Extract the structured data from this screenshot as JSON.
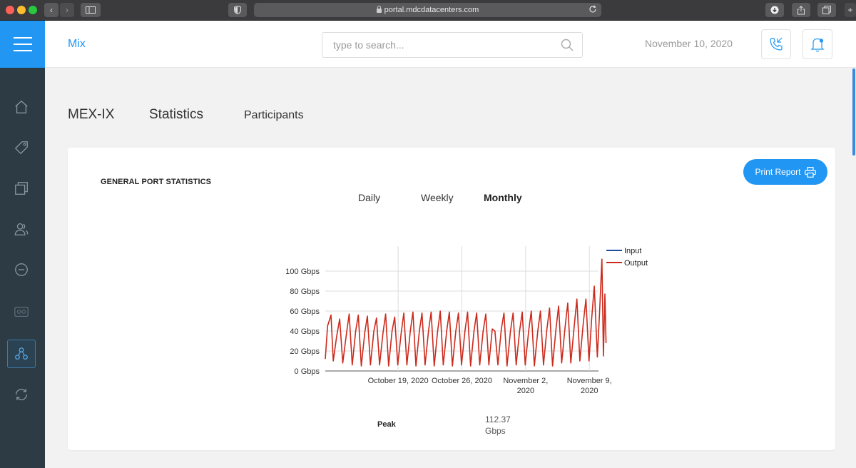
{
  "browser": {
    "url": "portal.mdcdatacenters.com"
  },
  "header": {
    "brand": "Mix",
    "search_placeholder": "type to search...",
    "date": "November 10, 2020"
  },
  "sidebar": {
    "items": [
      {
        "name": "home",
        "icon": "home-icon"
      },
      {
        "name": "tags",
        "icon": "tag-icon"
      },
      {
        "name": "copy",
        "icon": "copy-icon"
      },
      {
        "name": "users",
        "icon": "users-icon"
      },
      {
        "name": "minus",
        "icon": "minus-circle-icon"
      },
      {
        "name": "ports",
        "icon": "ports-icon"
      },
      {
        "name": "network",
        "icon": "network-icon",
        "active": true
      },
      {
        "name": "refresh",
        "icon": "refresh-icon"
      }
    ]
  },
  "page_tabs": {
    "site": "MEX-IX",
    "statistics": "Statistics",
    "participants": "Participants"
  },
  "card": {
    "title": "GENERAL PORT STATISTICS",
    "print_label": "Print Report",
    "periods": [
      "Daily",
      "Weekly",
      "Monthly"
    ],
    "selected_period": "Monthly",
    "peak_label": "Peak",
    "peak_value": "112.37 Gbps"
  },
  "colors": {
    "accent": "#2196f3",
    "input": "#1f4ea1",
    "output": "#cc2a1c"
  },
  "chart_data": {
    "type": "line",
    "y_ticks": [
      "100 Gbps",
      "80 Gbps",
      "60 Gbps",
      "40 Gbps",
      "20 Gbps",
      "0 Gbps"
    ],
    "y_tick_values": [
      100,
      80,
      60,
      40,
      20,
      0
    ],
    "ylim": [
      0,
      125
    ],
    "x_ticks": [
      {
        "label": [
          "October 19, 2020"
        ],
        "date": "2020-10-19"
      },
      {
        "label": [
          "October 26, 2020"
        ],
        "date": "2020-10-26"
      },
      {
        "label": [
          "November 2,",
          "2020"
        ],
        "date": "2020-11-02"
      },
      {
        "label": [
          "November 9,",
          "2020"
        ],
        "date": "2020-11-09"
      }
    ],
    "xlim": [
      "2020-10-11",
      "2020-11-10"
    ],
    "legend_position": "right",
    "grid": true,
    "series": [
      {
        "name": "Input",
        "color": "#1f4ea1",
        "points": []
      },
      {
        "name": "Output",
        "color": "#cc2a1c",
        "points": [
          [
            "2020-10-11 00:00",
            12
          ],
          [
            "2020-10-11 06:00",
            45
          ],
          [
            "2020-10-11 15:00",
            56
          ],
          [
            "2020-10-11 21:00",
            10
          ],
          [
            "2020-10-12 06:00",
            35
          ],
          [
            "2020-10-12 14:00",
            52
          ],
          [
            "2020-10-12 22:00",
            8
          ],
          [
            "2020-10-13 08:00",
            38
          ],
          [
            "2020-10-13 15:00",
            57
          ],
          [
            "2020-10-13 23:00",
            6
          ],
          [
            "2020-10-14 08:00",
            40
          ],
          [
            "2020-10-14 15:00",
            56
          ],
          [
            "2020-10-14 23:00",
            5
          ],
          [
            "2020-10-15 08:00",
            38
          ],
          [
            "2020-10-15 15:00",
            55
          ],
          [
            "2020-10-15 23:00",
            6
          ],
          [
            "2020-10-16 08:00",
            40
          ],
          [
            "2020-10-16 15:00",
            53
          ],
          [
            "2020-10-16 23:00",
            6
          ],
          [
            "2020-10-17 08:00",
            38
          ],
          [
            "2020-10-17 15:00",
            57
          ],
          [
            "2020-10-17 23:00",
            5
          ],
          [
            "2020-10-18 08:00",
            40
          ],
          [
            "2020-10-18 15:00",
            54
          ],
          [
            "2020-10-18 23:00",
            6
          ],
          [
            "2020-10-19 08:00",
            38
          ],
          [
            "2020-10-19 15:00",
            58
          ],
          [
            "2020-10-19 23:00",
            6
          ],
          [
            "2020-10-20 08:00",
            40
          ],
          [
            "2020-10-20 15:00",
            59
          ],
          [
            "2020-10-20 23:00",
            5
          ],
          [
            "2020-10-21 08:00",
            40
          ],
          [
            "2020-10-21 15:00",
            58
          ],
          [
            "2020-10-21 23:00",
            6
          ],
          [
            "2020-10-22 08:00",
            40
          ],
          [
            "2020-10-22 15:00",
            59
          ],
          [
            "2020-10-22 23:00",
            5
          ],
          [
            "2020-10-23 08:00",
            40
          ],
          [
            "2020-10-23 15:00",
            60
          ],
          [
            "2020-10-23 23:00",
            6
          ],
          [
            "2020-10-24 08:00",
            40
          ],
          [
            "2020-10-24 15:00",
            59
          ],
          [
            "2020-10-24 23:00",
            5
          ],
          [
            "2020-10-25 08:00",
            40
          ],
          [
            "2020-10-25 15:00",
            58
          ],
          [
            "2020-10-25 23:00",
            6
          ],
          [
            "2020-10-26 08:00",
            40
          ],
          [
            "2020-10-26 15:00",
            59
          ],
          [
            "2020-10-26 23:00",
            5
          ],
          [
            "2020-10-27 08:00",
            40
          ],
          [
            "2020-10-27 15:00",
            58
          ],
          [
            "2020-10-27 23:00",
            6
          ],
          [
            "2020-10-28 08:00",
            40
          ],
          [
            "2020-10-28 15:00",
            57
          ],
          [
            "2020-10-28 23:00",
            6
          ],
          [
            "2020-10-29 08:00",
            42
          ],
          [
            "2020-10-29 15:00",
            40
          ],
          [
            "2020-10-29 23:00",
            6
          ],
          [
            "2020-10-30 08:00",
            42
          ],
          [
            "2020-10-30 15:00",
            58
          ],
          [
            "2020-10-30 23:00",
            5
          ],
          [
            "2020-10-31 08:00",
            40
          ],
          [
            "2020-10-31 15:00",
            58
          ],
          [
            "2020-10-31 23:00",
            6
          ],
          [
            "2020-11-01 08:00",
            40
          ],
          [
            "2020-11-01 15:00",
            59
          ],
          [
            "2020-11-01 23:00",
            6
          ],
          [
            "2020-11-02 08:00",
            40
          ],
          [
            "2020-11-02 15:00",
            60
          ],
          [
            "2020-11-02 23:00",
            5
          ],
          [
            "2020-11-03 08:00",
            40
          ],
          [
            "2020-11-03 15:00",
            60
          ],
          [
            "2020-11-03 23:00",
            6
          ],
          [
            "2020-11-04 08:00",
            42
          ],
          [
            "2020-11-04 15:00",
            63
          ],
          [
            "2020-11-04 23:00",
            5
          ],
          [
            "2020-11-05 08:00",
            42
          ],
          [
            "2020-11-05 15:00",
            65
          ],
          [
            "2020-11-05 23:00",
            8
          ],
          [
            "2020-11-06 08:00",
            44
          ],
          [
            "2020-11-06 15:00",
            68
          ],
          [
            "2020-11-06 23:00",
            8
          ],
          [
            "2020-11-07 08:00",
            45
          ],
          [
            "2020-11-07 15:00",
            72
          ],
          [
            "2020-11-07 23:00",
            10
          ],
          [
            "2020-11-08 08:00",
            48
          ],
          [
            "2020-11-08 15:00",
            72
          ],
          [
            "2020-11-08 23:00",
            10
          ],
          [
            "2020-11-09 06:00",
            52
          ],
          [
            "2020-11-09 13:00",
            85
          ],
          [
            "2020-11-09 21:00",
            14
          ],
          [
            "2020-11-10 03:00",
            60
          ],
          [
            "2020-11-10 09:00",
            112
          ],
          [
            "2020-11-10 13:00",
            15
          ],
          [
            "2020-11-10 17:00",
            77
          ],
          [
            "2020-11-10 20:00",
            28
          ]
        ]
      }
    ]
  }
}
